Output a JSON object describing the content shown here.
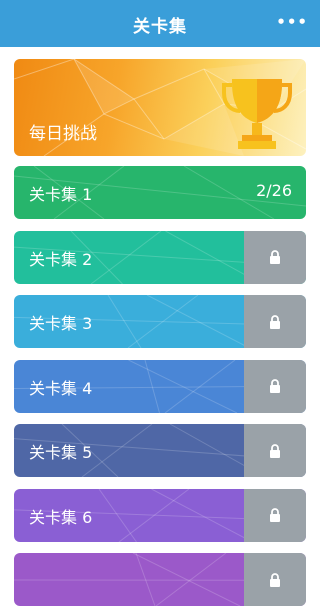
{
  "header": {
    "title": "关卡集",
    "more_icon": "more-icon",
    "more_glyph": "•••"
  },
  "daily": {
    "label": "每日挑战",
    "icon": "trophy-icon"
  },
  "levels": [
    {
      "name": "关卡集 1",
      "progress": "2/26",
      "locked": false,
      "color": "#27b56c"
    },
    {
      "name": "关卡集 2",
      "locked": true,
      "color": "#22bf9c"
    },
    {
      "name": "关卡集 3",
      "locked": true,
      "color": "#3aaedb"
    },
    {
      "name": "关卡集 4",
      "locked": true,
      "color": "#4a86d6"
    },
    {
      "name": "关卡集 5",
      "locked": true,
      "color": "#4f67a6"
    },
    {
      "name": "关卡集 6",
      "locked": true,
      "color": "#8a5fd4"
    },
    {
      "name": "",
      "locked": true,
      "color": "#9b59c9"
    }
  ],
  "colors": {
    "header": "#3a9ed9",
    "lock": "#9aa2a8"
  }
}
